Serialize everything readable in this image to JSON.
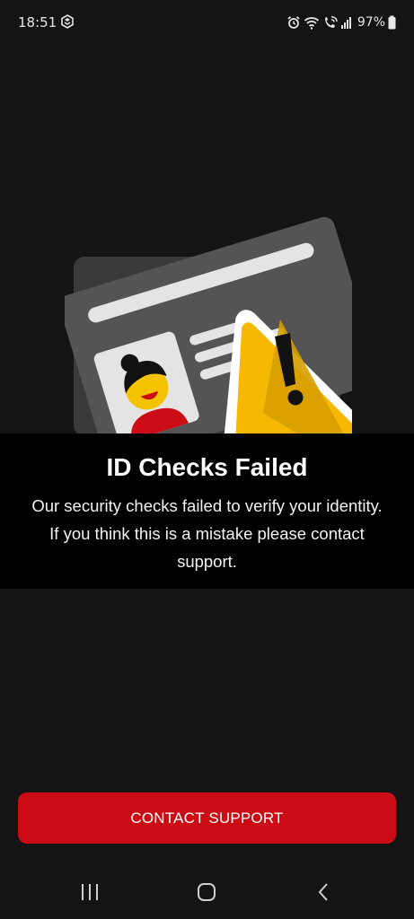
{
  "status_bar": {
    "time": "18:51",
    "battery": "97%",
    "icons": [
      "app-notification-icon",
      "alarm-icon",
      "wifi-icon",
      "wifi-calling-icon",
      "signal-icon",
      "battery-icon"
    ]
  },
  "illustration": {
    "icons": [
      "id-card-icon",
      "warning-triangle-icon"
    ],
    "colors": {
      "card": "#545454",
      "card_back": "#3a3a3a",
      "lines": "#e4e4e4",
      "face": "#f5c200",
      "shirt": "#cc0c14",
      "warning": "#f6b800"
    }
  },
  "message": {
    "title": "ID Checks Failed",
    "body": "Our security checks failed to verify your identity. If you think this is a mistake please contact support."
  },
  "actions": {
    "contact_support_label": "CONTACT SUPPORT"
  },
  "nav_bar": {
    "icons": [
      "recent-apps-icon",
      "home-icon",
      "back-icon"
    ]
  },
  "colors": {
    "background": "#141414",
    "band": "#000000",
    "accent": "#cc0c14"
  }
}
